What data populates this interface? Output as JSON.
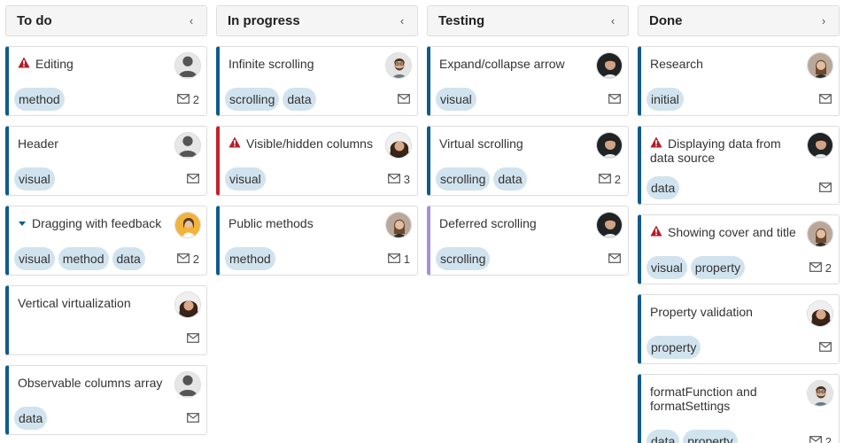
{
  "columns": [
    {
      "title": "To do",
      "toggle": "‹",
      "cards": [
        {
          "title": "Editing",
          "icon": "warning-icon",
          "avatar": "generic",
          "tags": [
            "method"
          ],
          "comments": "2",
          "accent": "blue"
        },
        {
          "title": "Header",
          "icon": "",
          "avatar": "generic",
          "tags": [
            "visual"
          ],
          "comments": "",
          "accent": "blue"
        },
        {
          "title": "Dragging with feedback",
          "icon": "caret-down-icon",
          "avatar": "woman-yellow",
          "tags": [
            "visual",
            "method",
            "data"
          ],
          "comments": "2",
          "accent": "blue"
        },
        {
          "title": "Vertical virtualization",
          "icon": "",
          "avatar": "woman-curly",
          "tags": [],
          "comments": "",
          "accent": "blue"
        },
        {
          "title": "Observable columns array",
          "icon": "",
          "avatar": "generic",
          "tags": [
            "data"
          ],
          "comments": "",
          "accent": "blue"
        }
      ]
    },
    {
      "title": "In progress",
      "toggle": "‹",
      "cards": [
        {
          "title": "Infinite scrolling",
          "icon": "",
          "avatar": "man-beard",
          "tags": [
            "scrolling",
            "data"
          ],
          "comments": "",
          "accent": "blue"
        },
        {
          "title": "Visible/hidden columns",
          "icon": "warning-icon",
          "avatar": "woman-curly",
          "tags": [
            "visual"
          ],
          "comments": "3",
          "accent": "red"
        },
        {
          "title": "Public methods",
          "icon": "",
          "avatar": "woman-blonde",
          "tags": [
            "method"
          ],
          "comments": "1",
          "accent": "blue"
        }
      ]
    },
    {
      "title": "Testing",
      "toggle": "‹",
      "cards": [
        {
          "title": "Expand/collapse arrow",
          "icon": "",
          "avatar": "man-dark",
          "tags": [
            "visual"
          ],
          "comments": "",
          "accent": "blue"
        },
        {
          "title": "Virtual scrolling",
          "icon": "",
          "avatar": "man-dark",
          "tags": [
            "scrolling",
            "data"
          ],
          "comments": "2",
          "accent": "blue"
        },
        {
          "title": "Deferred scrolling",
          "icon": "",
          "avatar": "man-dark",
          "tags": [
            "scrolling"
          ],
          "comments": "",
          "accent": "purple"
        }
      ]
    },
    {
      "title": "Done",
      "toggle": "›",
      "cards": [
        {
          "title": "Research",
          "icon": "",
          "avatar": "woman-blonde",
          "tags": [
            "initial"
          ],
          "comments": "",
          "accent": "blue"
        },
        {
          "title": "Displaying data from data source",
          "icon": "warning-icon",
          "avatar": "man-dark",
          "tags": [
            "data"
          ],
          "comments": "",
          "accent": "blue"
        },
        {
          "title": "Showing cover and title",
          "icon": "warning-icon",
          "avatar": "woman-blonde",
          "tags": [
            "visual",
            "property"
          ],
          "comments": "2",
          "accent": "blue"
        },
        {
          "title": "Property validation",
          "icon": "",
          "avatar": "woman-curly",
          "tags": [
            "property"
          ],
          "comments": "",
          "accent": "blue"
        },
        {
          "title": "formatFunction and formatSettings",
          "icon": "",
          "avatar": "man-beard",
          "tags": [
            "data",
            "property"
          ],
          "comments": "2",
          "accent": "blue"
        }
      ]
    }
  ],
  "colors": {
    "accent_blue": "#0f5b8c",
    "accent_red": "#c8202b",
    "accent_purple": "#a593d3",
    "tag_bg": "#d1e3ee",
    "warning": "#b01c26"
  }
}
